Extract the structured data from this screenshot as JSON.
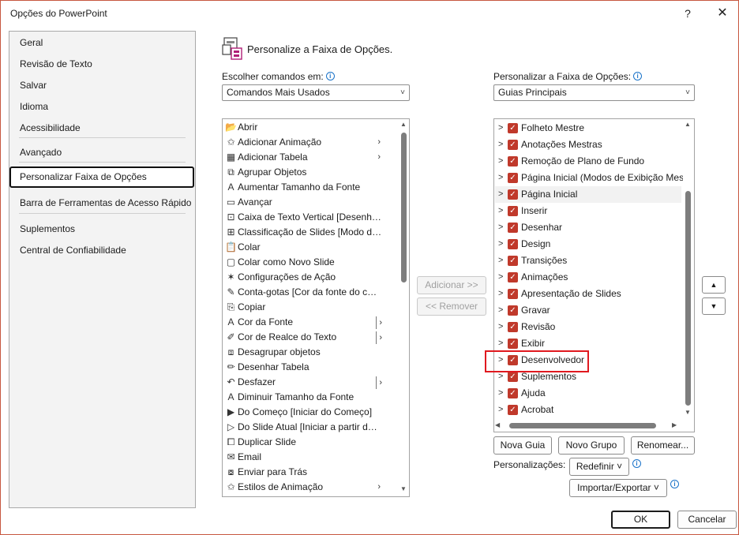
{
  "window": {
    "title": "Opções do PowerPoint",
    "help_glyph": "?",
    "close_glyph": "✕"
  },
  "nav": {
    "items": [
      {
        "label": "Geral"
      },
      {
        "label": "Revisão de Texto"
      },
      {
        "label": "Salvar"
      },
      {
        "label": "Idioma"
      },
      {
        "label": "Acessibilidade"
      },
      {
        "label": "Avançado"
      },
      {
        "label": "Personalizar Faixa de Opções"
      },
      {
        "label": "Barra de Ferramentas de Acesso Rápido"
      },
      {
        "label": "Suplementos"
      },
      {
        "label": "Central de Confiabilidade"
      }
    ],
    "selected": "Personalizar Faixa de Opções"
  },
  "header": {
    "title": "Personalize a Faixa de Opções.",
    "icon": "customize-ribbon-icon"
  },
  "left": {
    "label": "Escolher comandos em:",
    "combo_value": "Comandos Mais Usados",
    "commands": [
      {
        "label": "Abrir",
        "icon": "folder-open-icon",
        "glyph": "📂"
      },
      {
        "label": "Adicionar Animação",
        "icon": "add-animation-icon",
        "glyph": "✩",
        "sub": "›"
      },
      {
        "label": "Adicionar Tabela",
        "icon": "table-icon",
        "glyph": "▦",
        "sub": "›"
      },
      {
        "label": "Agrupar Objetos",
        "icon": "group-icon",
        "glyph": "⧉"
      },
      {
        "label": "Aumentar Tamanho da Fonte",
        "icon": "grow-font-icon",
        "glyph": "A"
      },
      {
        "label": "Avançar",
        "icon": "next-icon",
        "glyph": "▭"
      },
      {
        "label": "Caixa de Texto Vertical [Desenh…",
        "icon": "vertical-textbox-icon",
        "glyph": "⊡"
      },
      {
        "label": "Classificação de Slides [Modo d…",
        "icon": "slide-sorter-icon",
        "glyph": "⊞"
      },
      {
        "label": "Colar",
        "icon": "paste-icon",
        "glyph": "📋"
      },
      {
        "label": "Colar como Novo Slide",
        "icon": "paste-slide-icon",
        "glyph": "▢"
      },
      {
        "label": "Configurações de Ação",
        "icon": "action-icon",
        "glyph": "✶"
      },
      {
        "label": "Conta-gotas [Cor da fonte do c…",
        "icon": "eyedropper-icon",
        "glyph": "✎"
      },
      {
        "label": "Copiar",
        "icon": "copy-icon",
        "glyph": "⎘"
      },
      {
        "label": "Cor da Fonte",
        "icon": "font-color-icon",
        "glyph": "A",
        "subbar": "›"
      },
      {
        "label": "Cor de Realce do Texto",
        "icon": "highlight-icon",
        "glyph": "✐",
        "subbar": "›"
      },
      {
        "label": "Desagrupar objetos",
        "icon": "ungroup-icon",
        "glyph": "⧈"
      },
      {
        "label": "Desenhar Tabela",
        "icon": "draw-table-icon",
        "glyph": "✏"
      },
      {
        "label": "Desfazer",
        "icon": "undo-icon",
        "glyph": "↶",
        "subbar": "›"
      },
      {
        "label": "Diminuir Tamanho da Fonte",
        "icon": "shrink-font-icon",
        "glyph": "A"
      },
      {
        "label": "Do Começo [Iniciar do Começo]",
        "icon": "from-beginning-icon",
        "glyph": "▶"
      },
      {
        "label": "Do Slide Atual [Iniciar a partir d…",
        "icon": "from-current-icon",
        "glyph": "▷"
      },
      {
        "label": "Duplicar Slide",
        "icon": "duplicate-icon",
        "glyph": "⧠"
      },
      {
        "label": "Email",
        "icon": "email-icon",
        "glyph": "✉"
      },
      {
        "label": "Enviar para Trás",
        "icon": "send-back-icon",
        "glyph": "⧇"
      },
      {
        "label": "Estilos de Animação",
        "icon": "animation-styles-icon",
        "glyph": "✩",
        "sub": "›"
      }
    ]
  },
  "middle": {
    "add_label": "Adicionar >>",
    "remove_label": "<< Remover"
  },
  "right": {
    "label": "Personalizar a Faixa de Opções:",
    "combo_value": "Guias Principais",
    "tabs": [
      {
        "label": "Folheto Mestre"
      },
      {
        "label": "Anotações Mestras"
      },
      {
        "label": "Remoção de Plano de Fundo"
      },
      {
        "label": "Página Inicial (Modos de Exibição Mest"
      },
      {
        "label": "Página Inicial"
      },
      {
        "label": "Inserir"
      },
      {
        "label": "Desenhar"
      },
      {
        "label": "Design"
      },
      {
        "label": "Transições"
      },
      {
        "label": "Animações"
      },
      {
        "label": "Apresentação de Slides"
      },
      {
        "label": "Gravar"
      },
      {
        "label": "Revisão"
      },
      {
        "label": "Exibir"
      },
      {
        "label": "Desenvolvedor"
      },
      {
        "label": "Suplementos"
      },
      {
        "label": "Ajuda"
      },
      {
        "label": "Acrobat"
      }
    ],
    "expand_glyph": ">",
    "check_glyph": "✓",
    "new_tab_label": "Nova Guia",
    "new_group_label": "Novo Grupo",
    "rename_label": "Renomear...",
    "customizations_label": "Personalizações:",
    "reset_label": "Redefinir ˅",
    "import_export_label": "Importar/Exportar ˅",
    "up_glyph": "▲",
    "down_glyph": "▼"
  },
  "footer": {
    "ok_label": "OK",
    "cancel_label": "Cancelar"
  }
}
